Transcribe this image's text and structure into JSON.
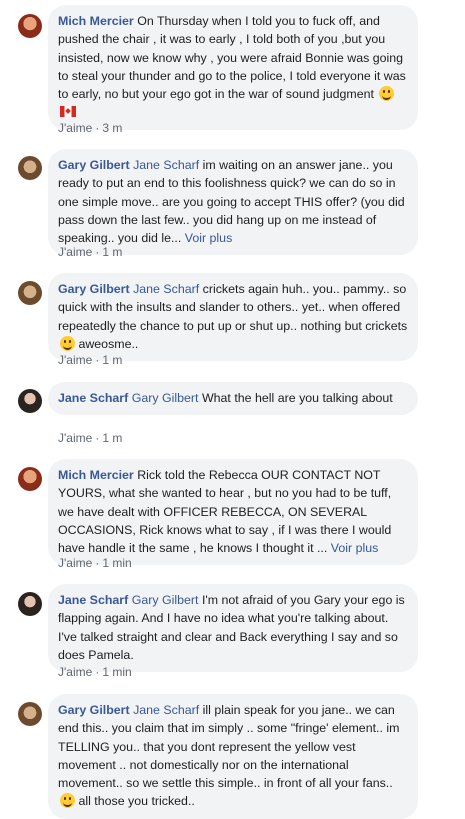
{
  "comments": [
    {
      "author": "Mich Mercier",
      "tag": "",
      "text": "On Thursday when I told you to fuck off, and pushed the chair , it was to early , I told both of you ,but you insisted, now we know why , you were afraid Bonnie was going to steal your thunder and go to the police, I told everyone it was to early, no but your ego got in the war of sound judgment",
      "emojis": [
        "grinning-squinting-emoji",
        "canada-flag-emoji"
      ],
      "see_more": "",
      "like": "J'aime",
      "time": "3 m"
    },
    {
      "author": "Gary Gilbert",
      "tag": "Jane Scharf",
      "text": "im waiting on an answer jane.. you ready to put an end to this foolishness quick? we can do so in one simple move.. are you going to accept THIS offer? (you did pass down the last few.. you did hang up on me instead of speaking.. you did le...",
      "emojis": [],
      "see_more": "Voir plus",
      "like": "J'aime",
      "time": "1 m"
    },
    {
      "author": "Gary Gilbert",
      "tag": "Jane Scharf",
      "text": "crickets again huh.. you.. pammy.. so quick with the insults and slander to others.. yet.. when offered repeatedly the chance to put up or shut up.. nothing but crickets",
      "text_after": " aweosme..",
      "emojis": [
        "smiling-emoji"
      ],
      "see_more": "",
      "like": "J'aime",
      "time": "1 m"
    },
    {
      "author": "Jane Scharf",
      "tag": "Gary Gilbert",
      "text": "What the hell are you talking about",
      "emojis": [],
      "see_more": "",
      "like": "J'aime",
      "time": "1 m"
    },
    {
      "author": "Mich Mercier",
      "tag": "",
      "text": "Rick told the Rebecca OUR CONTACT NOT YOURS, what she wanted to hear , but no you had to be tuff, we have dealt with OFFICER REBECCA, ON SEVERAL OCCASIONS, Rick knows what to say , if I was there I would have handle it the same , he knows I thought it ...",
      "emojis": [],
      "see_more": "Voir plus",
      "like": "J'aime",
      "time": "1 min"
    },
    {
      "author": "Jane Scharf",
      "tag": "Gary Gilbert",
      "text": "I'm not afraid of you Gary your ego is flapping again. And I have no idea what you're talking about. I've talked straight and clear and Back everything I say and so does Pamela.",
      "emojis": [],
      "see_more": "",
      "like": "J'aime",
      "time": "1 min"
    },
    {
      "author": "Gary Gilbert",
      "tag": "Jane Scharf",
      "text": "ill plain speak for you jane.. we can end this.. you claim that im simply .. some \"fringe' element.. im TELLING you.. that you dont represent the yellow vest movement .. not domestically nor on the international movement.. so we settle this simple.. in front of all your fans..",
      "text_after": " all those you tricked..",
      "emojis": [
        "smiling-emoji"
      ],
      "see_more": "",
      "like": "",
      "time": ""
    }
  ],
  "colors": {
    "link": "#385898",
    "bubble": "#f2f3f5",
    "meta": "#606770"
  }
}
